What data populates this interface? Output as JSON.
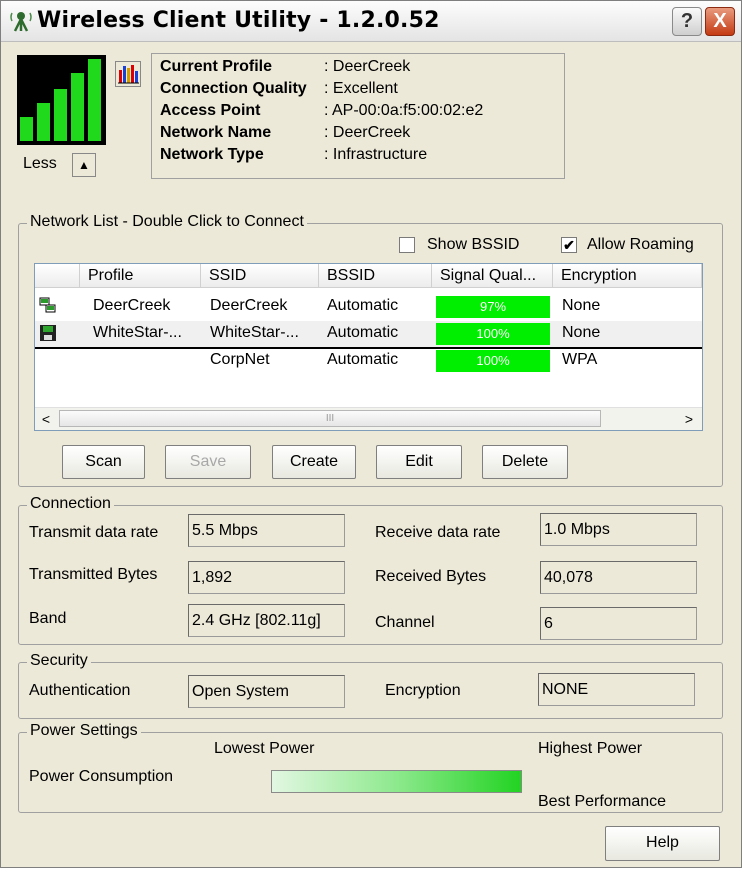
{
  "window": {
    "title": "Wireless Client Utility - 1.2.0.52",
    "help_button": "?",
    "close_button": "X"
  },
  "signal": {
    "bars": 5,
    "less_label": "Less",
    "toggle_glyph": "▲"
  },
  "status": {
    "rows": [
      {
        "key": "Current Profile",
        "value": ": DeerCreek"
      },
      {
        "key": "Connection Quality",
        "value": ": Excellent"
      },
      {
        "key": "Access Point",
        "value": ": AP-00:0a:f5:00:02:e2"
      },
      {
        "key": "Network Name",
        "value": ": DeerCreek"
      },
      {
        "key": "Network Type",
        "value": ": Infrastructure"
      }
    ]
  },
  "network_list": {
    "legend": "Network List - Double Click to Connect",
    "show_bssid": {
      "label": "Show BSSID",
      "checked": false
    },
    "allow_roaming": {
      "label": "Allow Roaming",
      "checked": true,
      "mark": "✔"
    },
    "columns": [
      "Profile",
      "SSID",
      "BSSID",
      "Signal Qual...",
      "Encryption"
    ],
    "rows": [
      {
        "icon": "connected-network-icon",
        "profile": "DeerCreek",
        "ssid": "DeerCreek",
        "bssid": "Automatic",
        "signal": "97%",
        "signal_value": 97,
        "encryption": "None"
      },
      {
        "icon": "saved-profile-icon",
        "profile": "WhiteStar-...",
        "ssid": "WhiteStar-...",
        "bssid": "Automatic",
        "signal": "100%",
        "signal_value": 100,
        "encryption": "None"
      },
      {
        "icon": "",
        "profile": "",
        "ssid": "CorpNet",
        "bssid": "Automatic",
        "signal": "100%",
        "signal_value": 100,
        "encryption": "WPA"
      }
    ],
    "scroll_left": "<",
    "scroll_right": ">",
    "thumb_grip": "III"
  },
  "buttons": {
    "scan": "Scan",
    "save": "Save",
    "create": "Create",
    "edit": "Edit",
    "delete": "Delete",
    "help": "Help"
  },
  "connection": {
    "legend": "Connection",
    "transmit_rate_label": "Transmit data rate",
    "transmit_rate": "5.5 Mbps",
    "receive_rate_label": "Receive data rate",
    "receive_rate": "1.0 Mbps",
    "tx_bytes_label": "Transmitted Bytes",
    "tx_bytes": "1,892",
    "rx_bytes_label": "Received Bytes",
    "rx_bytes": "40,078",
    "band_label": "Band",
    "band": "2.4 GHz [802.11g]",
    "channel_label": "Channel",
    "channel": "6"
  },
  "security": {
    "legend": "Security",
    "auth_label": "Authentication",
    "auth": "Open System",
    "encryption_label": "Encryption",
    "encryption": "NONE"
  },
  "power": {
    "legend": "Power Settings",
    "lowest": "Lowest Power",
    "highest": "Highest Power",
    "consumption_label": "Power Consumption",
    "best": "Best Performance"
  },
  "colors": {
    "signal_green": "#21d91c",
    "signal_cell": "#00ee00",
    "close_red": "#c43a13",
    "window_bg": "#ece9d8"
  }
}
